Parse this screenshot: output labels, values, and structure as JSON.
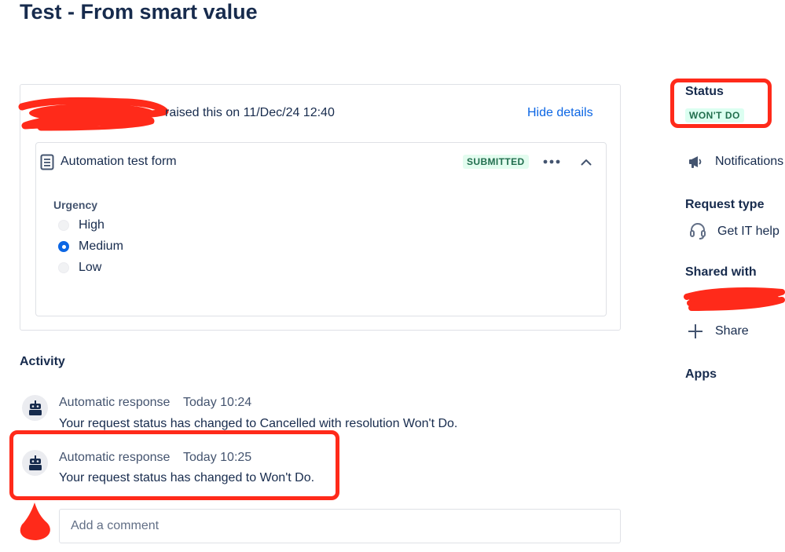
{
  "page": {
    "title": "Test - From smart value"
  },
  "request": {
    "raised_text": "raised this on 11/Dec/24 12:40",
    "hide_details_label": "Hide details"
  },
  "form": {
    "title": "Automation test form",
    "status_badge": "SUBMITTED",
    "field_label": "Urgency",
    "options": [
      {
        "label": "High",
        "selected": false
      },
      {
        "label": "Medium",
        "selected": true
      },
      {
        "label": "Low",
        "selected": false
      }
    ]
  },
  "activity": {
    "title": "Activity",
    "entries": [
      {
        "author": "Automatic response",
        "time": "Today 10:24",
        "message": "Your request status has changed to Cancelled with resolution Won't Do."
      },
      {
        "author": "Automatic response",
        "time": "Today 10:25",
        "message": "Your request status has changed to Won't Do."
      }
    ],
    "comment_placeholder": "Add a comment"
  },
  "sidebar": {
    "status_heading": "Status",
    "status_value": "WON'T DO",
    "notifications_label": "Notifications",
    "request_type_heading": "Request type",
    "request_type_value": "Get IT help",
    "shared_with_heading": "Shared with",
    "share_label": "Share",
    "apps_heading": "Apps"
  },
  "colors": {
    "text_primary": "#172b4d",
    "text_subtle": "#44546f",
    "link": "#0c66e4",
    "success_bg": "#dcfff1",
    "success_text": "#216e4e",
    "annotation_red": "#ff2a1a"
  },
  "icons": [
    "form-document-icon",
    "more-options-icon",
    "chevron-up-icon",
    "bot-avatar-icon",
    "megaphone-icon",
    "headset-icon",
    "plus-icon"
  ]
}
